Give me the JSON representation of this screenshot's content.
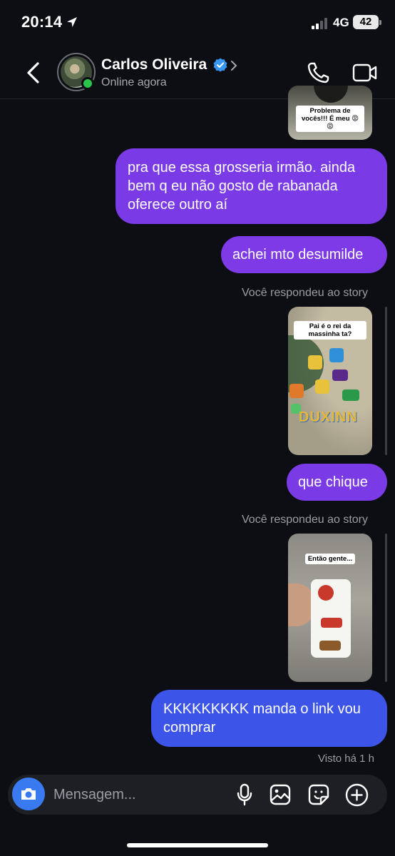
{
  "status_bar": {
    "time": "20:14",
    "network": "4G",
    "battery": "42"
  },
  "header": {
    "name": "Carlos Oliveira",
    "status": "Online agora"
  },
  "stories": [
    {
      "sticker": "Problema de vocês!!! É meu 😡😡"
    },
    {
      "sticker": "Pai é o rei da massinha ta?",
      "caption": "DUXINN"
    },
    {
      "sticker": "Então gente..."
    }
  ],
  "messages": [
    {
      "text": "pra que essa grosseria irmão. ainda bem q eu não gosto de rabanada oferece outro aí"
    },
    {
      "text": "achei mto desumilde"
    },
    {
      "text": "que chique"
    },
    {
      "text": "KKKKKKKKK manda o link vou comprar"
    }
  ],
  "reply_labels": [
    "Você respondeu ao story",
    "Você respondeu ao story"
  ],
  "seen": "Visto há 1 h",
  "composer": {
    "placeholder": "Mensagem..."
  },
  "colors": {
    "bubble_purple": "#7a3ae6",
    "bubble_blue": "#3c55e8",
    "accent": "#3a7af0",
    "online": "#2bc44a"
  }
}
